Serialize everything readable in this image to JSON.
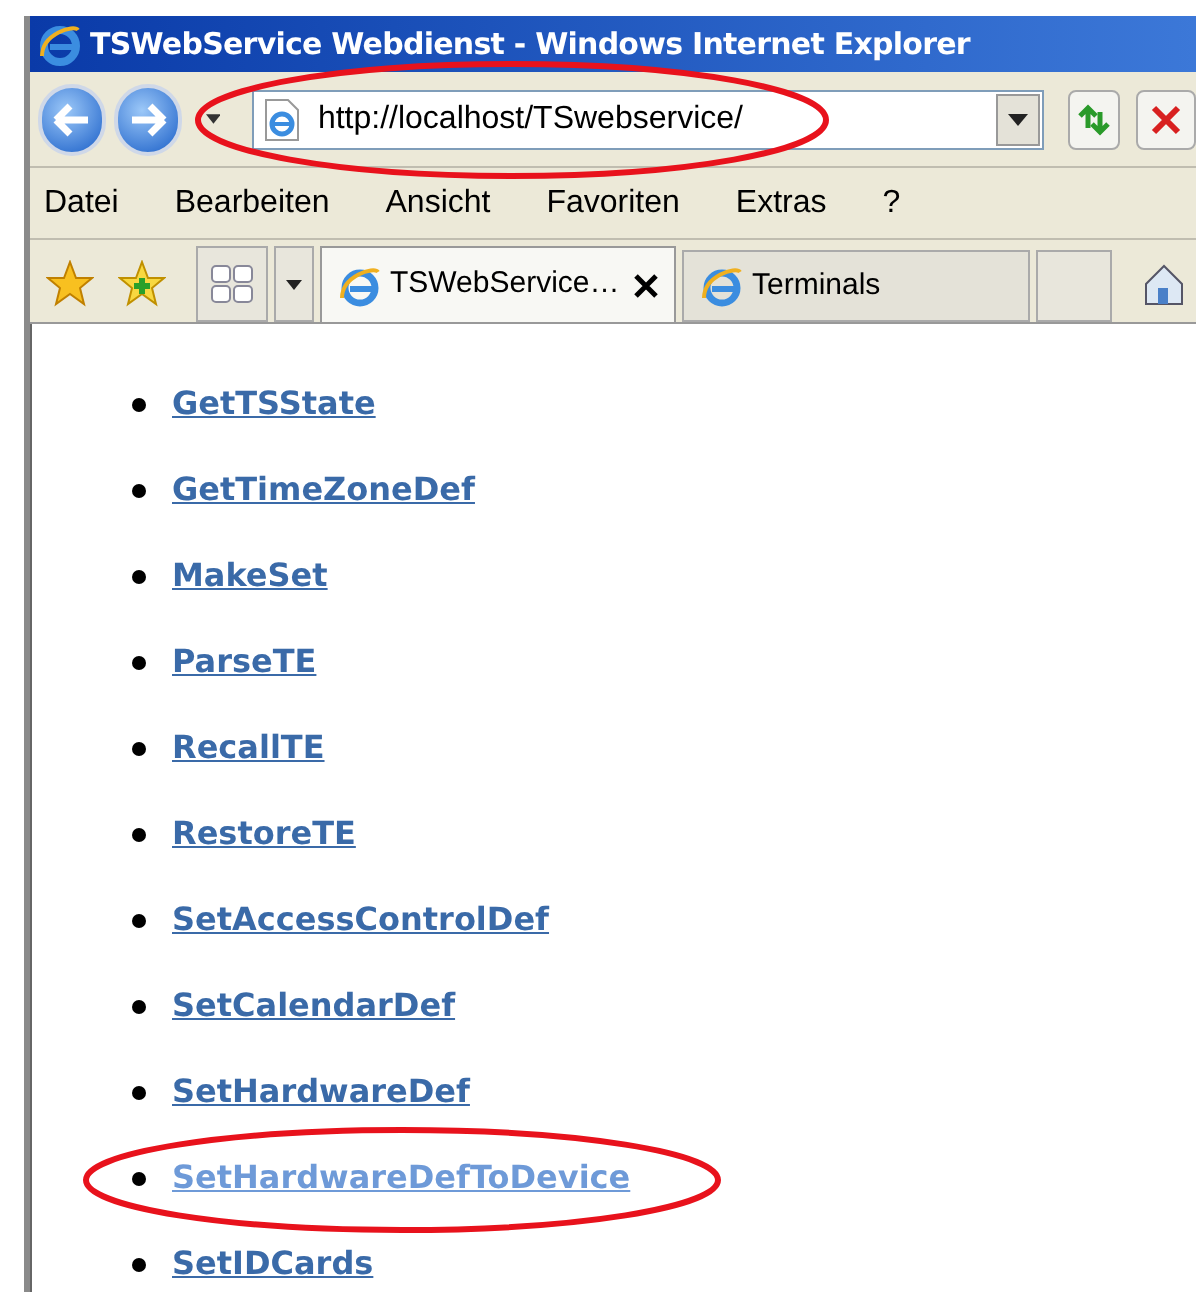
{
  "window": {
    "title": "TSWebService Webdienst - Windows Internet Explorer"
  },
  "address_bar": {
    "value": "http://localhost/TSwebservice/",
    "highlighted": true
  },
  "menu": [
    "Datei",
    "Bearbeiten",
    "Ansicht",
    "Favoriten",
    "Extras",
    "?"
  ],
  "tabs": [
    {
      "label": "TSWebService…",
      "selected": true,
      "closable": true
    },
    {
      "label": "Terminals",
      "selected": false,
      "closable": false
    }
  ],
  "links": [
    {
      "label": "GetTSState",
      "visited": false,
      "highlighted": false
    },
    {
      "label": "GetTimeZoneDef",
      "visited": false,
      "highlighted": false
    },
    {
      "label": "MakeSet",
      "visited": false,
      "highlighted": false
    },
    {
      "label": "ParseTE",
      "visited": false,
      "highlighted": false
    },
    {
      "label": "RecallTE",
      "visited": false,
      "highlighted": false
    },
    {
      "label": "RestoreTE",
      "visited": false,
      "highlighted": false
    },
    {
      "label": "SetAccessControlDef",
      "visited": false,
      "highlighted": false
    },
    {
      "label": "SetCalendarDef",
      "visited": false,
      "highlighted": false
    },
    {
      "label": "SetHardwareDef",
      "visited": false,
      "highlighted": false
    },
    {
      "label": "SetHardwareDefToDevice",
      "visited": true,
      "highlighted": true
    },
    {
      "label": "SetIDCards",
      "visited": false,
      "highlighted": false
    }
  ]
}
